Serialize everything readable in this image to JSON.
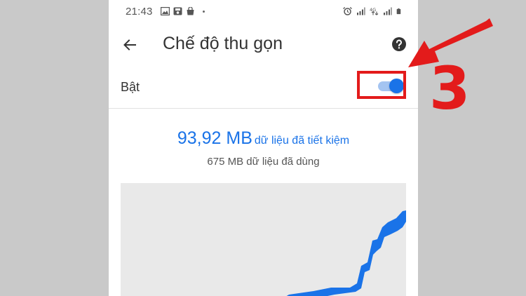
{
  "status_bar": {
    "time": "21:43",
    "left_icons": [
      "image-icon",
      "save-icon",
      "bag-icon"
    ],
    "right_icons": [
      "alarm-icon",
      "signal-icon",
      "network-4g-icon",
      "signal-icon-2",
      "battery-icon"
    ],
    "network_label": "4G"
  },
  "toolbar": {
    "title": "Chế độ thu gọn",
    "back_icon": "arrow-back-icon",
    "help_icon": "help-icon"
  },
  "setting": {
    "label": "Bật",
    "toggle_on": true,
    "accent_color": "#1a73e8",
    "track_color": "#a4c4f1"
  },
  "stats": {
    "saved_amount": "93,92 MB",
    "saved_suffix": "dữ liệu đã tiết kiệm",
    "used_text": "675 MB dữ liệu đã dùng"
  },
  "annotation": {
    "number": "3",
    "color": "#e31b1b"
  }
}
